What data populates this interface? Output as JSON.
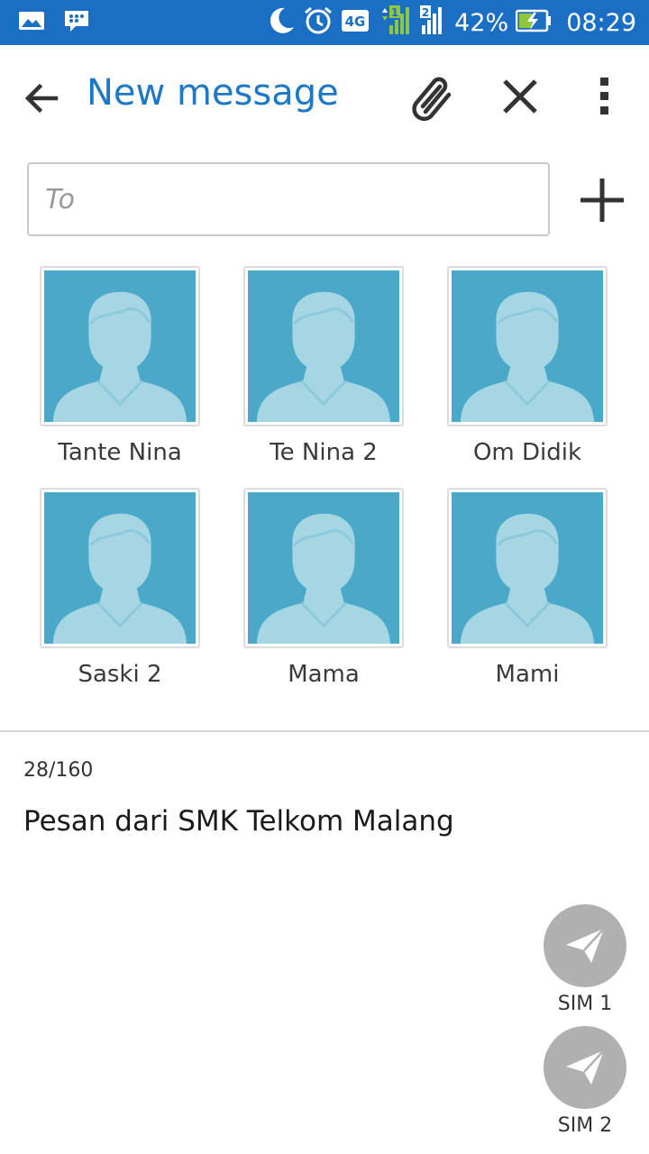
{
  "status_bar": {
    "battery": "42%",
    "time": "08:29",
    "network": "4G",
    "sim1_label": "1",
    "sim2_label": "2",
    "icons": [
      "gallery-icon",
      "bbm-icon",
      "moon-icon",
      "alarm-icon",
      "network-4g-icon",
      "signal-icon",
      "signal-icon",
      "battery-charging-icon"
    ]
  },
  "toolbar": {
    "title": "New message",
    "back_icon": "arrow-back-icon",
    "attach_icon": "paperclip-icon",
    "close_icon": "close-icon",
    "more_icon": "more-vert-icon"
  },
  "to_field": {
    "placeholder": "To",
    "value": ""
  },
  "contacts": [
    {
      "name": "Tante Nina"
    },
    {
      "name": "Te Nina 2"
    },
    {
      "name": "Om Didik"
    },
    {
      "name": "Saski 2"
    },
    {
      "name": "Mama"
    },
    {
      "name": "Mami"
    }
  ],
  "compose": {
    "counter": "28/160",
    "text": "Pesan dari SMK Telkom Malang"
  },
  "send": [
    {
      "label": "SIM 1"
    },
    {
      "label": "SIM 2"
    }
  ],
  "colors": {
    "status_bar": "#1a6fc4",
    "title": "#1e78c8",
    "avatar_bg": "#4aa9c9",
    "avatar_silhouette": "#a6d6e4",
    "send_button": "#b0b0b0"
  }
}
